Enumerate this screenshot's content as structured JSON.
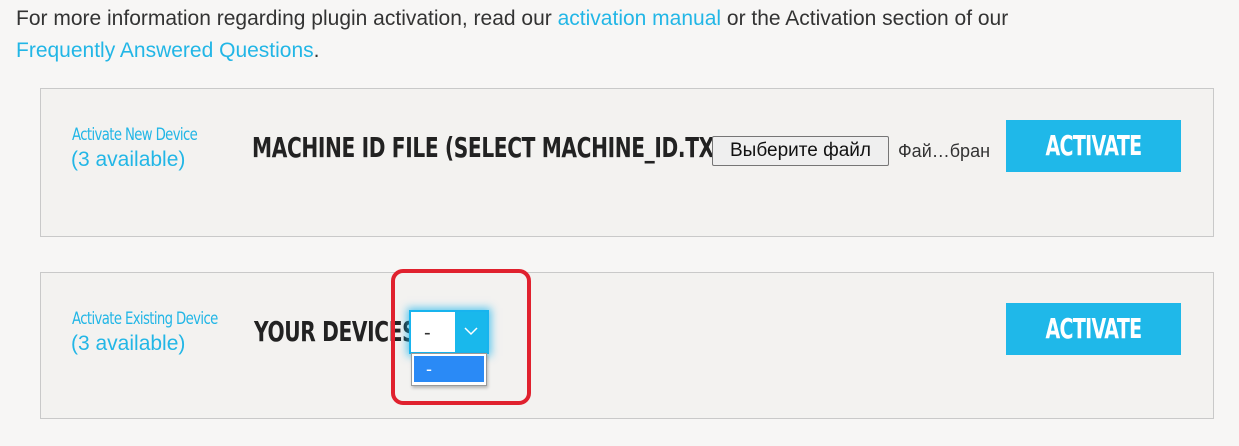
{
  "intro": {
    "text1": "For more information regarding plugin activation, read our ",
    "link1": "activation manual",
    "text2": " or the Activation section of our ",
    "link2": "Frequently Answered Questions",
    "text3": "."
  },
  "new_device": {
    "title": "Activate New Device",
    "available": "(3 available)",
    "field_label": "MACHINE ID FILE (SELECT MACHINE_ID.TXT FILE)",
    "file_button": "Выберите файл",
    "file_status": "Фай…бран",
    "activate_label": "ACTIVATE"
  },
  "existing_device": {
    "title": "Activate Existing Device",
    "available": "(3 available)",
    "field_label": "YOUR DEVICES",
    "select_value": "-",
    "options": [
      "-"
    ],
    "activate_label": "ACTIVATE"
  },
  "colors": {
    "accent": "#1fb8e9",
    "link": "#22b6e6",
    "highlight": "#e0212e",
    "option_selected": "#2a8af6"
  },
  "icons": {
    "select_arrow": "chevron-down-icon"
  }
}
